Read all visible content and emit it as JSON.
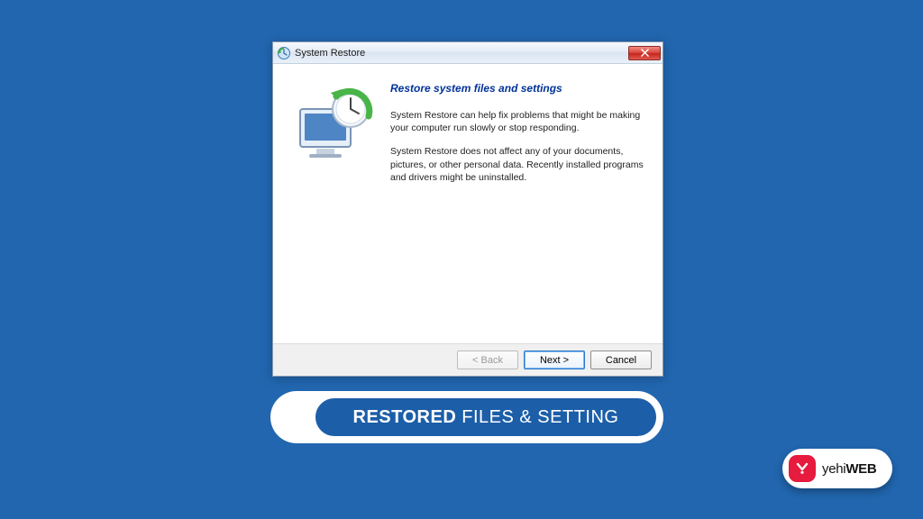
{
  "dialog": {
    "title": "System Restore",
    "heading": "Restore system files and settings",
    "para1": "System Restore can help fix problems that might be making your computer run slowly or stop responding.",
    "para2": "System Restore does not affect any of your documents, pictures, or other personal data. Recently installed programs and drivers might be uninstalled.",
    "buttons": {
      "back": "< Back",
      "next": "Next >",
      "cancel": "Cancel"
    }
  },
  "caption": {
    "bold": "RESTORED",
    "rest": "FILES & SETTING"
  },
  "badge": {
    "part1": "yehi",
    "part2": "WEB"
  }
}
